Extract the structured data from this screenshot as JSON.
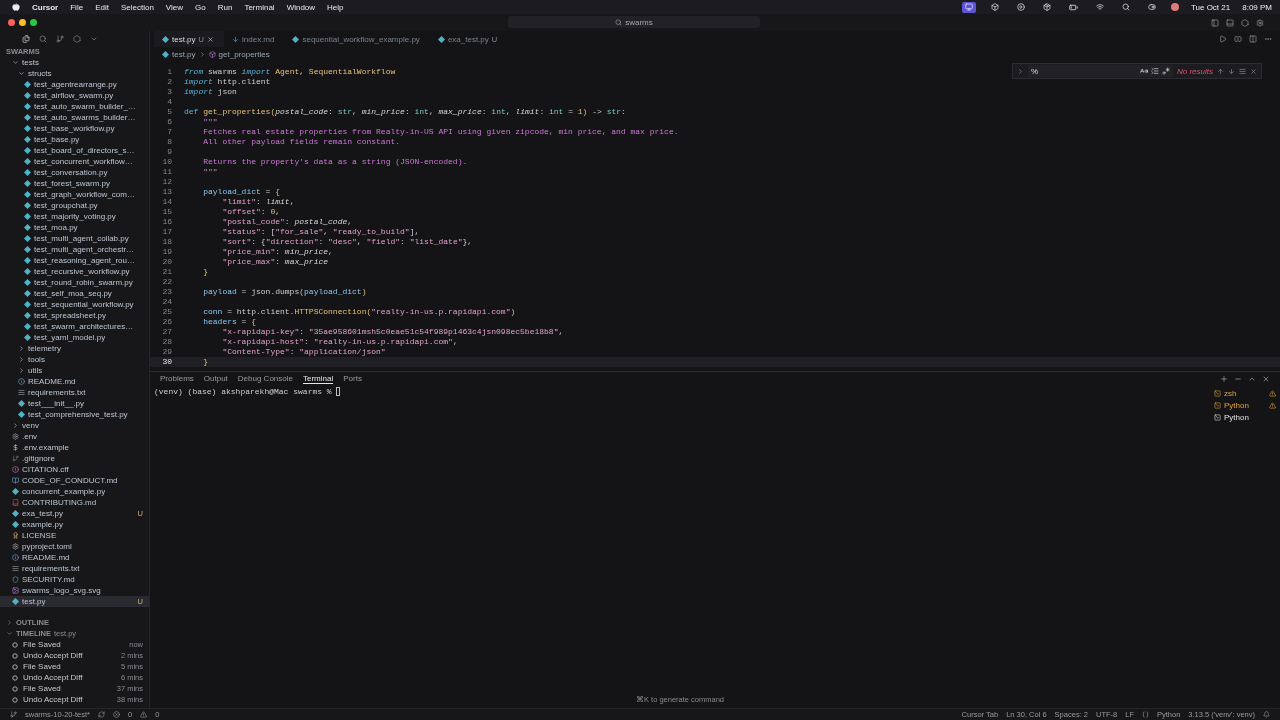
{
  "menu_bar": {
    "app": "Cursor",
    "items": [
      "File",
      "Edit",
      "Selection",
      "View",
      "Go",
      "Run",
      "Terminal",
      "Window",
      "Help"
    ],
    "date": "Tue Oct 21",
    "time": "8:09 PM"
  },
  "title_bar": {
    "search": "swarms"
  },
  "explorer": {
    "title": "SWARMS",
    "tree": [
      {
        "name": "tests",
        "kind": "folder",
        "expanded": true,
        "selected": false,
        "children": [
          {
            "name": "structs",
            "kind": "folder",
            "expanded": true,
            "selected": false,
            "children": [
              {
                "name": "test_agentrearrange.py",
                "kind": "python",
                "selected": false
              },
              {
                "name": "test_airflow_swarm.py",
                "kind": "python",
                "selected": false
              },
              {
                "name": "test_auto_swarm_builder_…",
                "kind": "python",
                "selected": false
              },
              {
                "name": "test_auto_swarms_builder…",
                "kind": "python",
                "selected": false
              },
              {
                "name": "test_base_workflow.py",
                "kind": "python",
                "selected": false
              },
              {
                "name": "test_base.py",
                "kind": "python",
                "selected": false
              },
              {
                "name": "test_board_of_directors_s…",
                "kind": "python",
                "selected": false
              },
              {
                "name": "test_concurrent_workflow…",
                "kind": "python",
                "selected": false
              },
              {
                "name": "test_conversation.py",
                "kind": "python",
                "selected": false
              },
              {
                "name": "test_forest_swarm.py",
                "kind": "python",
                "selected": false
              },
              {
                "name": "test_graph_workflow_com…",
                "kind": "python",
                "selected": false
              },
              {
                "name": "test_groupchat.py",
                "kind": "python",
                "selected": false
              },
              {
                "name": "test_majority_voting.py",
                "kind": "python",
                "selected": false
              },
              {
                "name": "test_moa.py",
                "kind": "python",
                "selected": false
              },
              {
                "name": "test_multi_agent_collab.py",
                "kind": "python",
                "selected": false
              },
              {
                "name": "test_multi_agent_orchestr…",
                "kind": "python",
                "selected": false
              },
              {
                "name": "test_reasoning_agent_rou…",
                "kind": "python",
                "selected": false
              },
              {
                "name": "test_recursive_workflow.py",
                "kind": "python",
                "selected": false
              },
              {
                "name": "test_round_robin_swarm.py",
                "kind": "python",
                "selected": false
              },
              {
                "name": "test_self_moa_seq.py",
                "kind": "python",
                "selected": false
              },
              {
                "name": "test_sequential_workflow.py",
                "kind": "python",
                "selected": false
              },
              {
                "name": "test_spreadsheet.py",
                "kind": "python",
                "selected": false
              },
              {
                "name": "test_swarm_architectures…",
                "kind": "python",
                "selected": false
              },
              {
                "name": "test_yaml_model.py",
                "kind": "python",
                "selected": false
              }
            ]
          },
          {
            "name": "telemetry",
            "kind": "folder",
            "expanded": false,
            "selected": false
          },
          {
            "name": "tools",
            "kind": "folder",
            "expanded": false,
            "selected": false
          },
          {
            "name": "utils",
            "kind": "folder",
            "expanded": false,
            "selected": false
          },
          {
            "name": "README.md",
            "kind": "info",
            "selected": false
          },
          {
            "name": "requirements.txt",
            "kind": "lines",
            "selected": false
          },
          {
            "name": "test___init__.py",
            "kind": "python",
            "selected": false
          },
          {
            "name": "test_comprehensive_test.py",
            "kind": "python",
            "selected": false
          }
        ]
      },
      {
        "name": "venv",
        "kind": "folder",
        "expanded": false,
        "selected": false
      },
      {
        "name": ".env",
        "kind": "gear",
        "selected": false
      },
      {
        "name": ".env.example",
        "kind": "dollar",
        "selected": false
      },
      {
        "name": ".gitignore",
        "kind": "git",
        "selected": false
      },
      {
        "name": "CITATION.cff",
        "kind": "alert",
        "selected": false
      },
      {
        "name": "CODE_OF_CONDUCT.md",
        "kind": "book",
        "selected": false
      },
      {
        "name": "concurrent_example.py",
        "kind": "python",
        "selected": false
      },
      {
        "name": "CONTRIBUTING.md",
        "kind": "redbook",
        "selected": false
      },
      {
        "name": "exa_test.py",
        "kind": "python",
        "selected": false,
        "badge": "U"
      },
      {
        "name": "example.py",
        "kind": "python",
        "selected": false
      },
      {
        "name": "LICENSE",
        "kind": "license",
        "selected": false
      },
      {
        "name": "pyproject.toml",
        "kind": "gear",
        "selected": false
      },
      {
        "name": "README.md",
        "kind": "info",
        "selected": false
      },
      {
        "name": "requirements.txt",
        "kind": "lines",
        "selected": false
      },
      {
        "name": "SECURITY.md",
        "kind": "shield",
        "selected": false
      },
      {
        "name": "swarms_logo_svg.svg",
        "kind": "image",
        "selected": false
      },
      {
        "name": "test.py",
        "kind": "python",
        "selected": true,
        "badge": "U"
      }
    ]
  },
  "outline": {
    "title": "OUTLINE",
    "expanded": false
  },
  "timeline": {
    "title": "TIMELINE",
    "file": "test.py",
    "expanded": true,
    "entries": [
      {
        "label": "File Saved",
        "time": "now"
      },
      {
        "label": "Undo Accept Diff",
        "time": "2 mins"
      },
      {
        "label": "File Saved",
        "time": "5 mins"
      },
      {
        "label": "Undo Accept Diff",
        "time": "6 mins"
      },
      {
        "label": "File Saved",
        "time": "37 mins"
      },
      {
        "label": "Undo Accept Diff",
        "time": "38 mins"
      }
    ]
  },
  "editor": {
    "tabs": [
      {
        "label": "test.py",
        "kind": "python",
        "badge": "U",
        "selected": true
      },
      {
        "label": "index.md",
        "kind": "markdown",
        "selected": false
      },
      {
        "label": "sequential_workflow_example.py",
        "kind": "python",
        "selected": false
      },
      {
        "label": "exa_test.py",
        "kind": "python",
        "badge": "U",
        "selected": false
      }
    ],
    "breadcrumb": [
      "test.py",
      "get_properties"
    ],
    "find": {
      "value": "%",
      "status": "No results"
    },
    "lines": [
      {
        "number": "1",
        "current": false,
        "tokens": [
          {
            "kind": "kw",
            "text": "from"
          },
          {
            "kind": "plain",
            "text": " swarms "
          },
          {
            "kind": "kw",
            "text": "import"
          },
          {
            "kind": "cls",
            "text": " Agent"
          },
          {
            "kind": "plain",
            "text": ", "
          },
          {
            "kind": "cls",
            "text": "SequentialWorkflow"
          }
        ]
      },
      {
        "number": "2",
        "current": false,
        "tokens": [
          {
            "kind": "kw",
            "text": "import"
          },
          {
            "kind": "plain",
            "text": " http.client"
          }
        ]
      },
      {
        "number": "3",
        "current": false,
        "tokens": [
          {
            "kind": "kw",
            "text": "import"
          },
          {
            "kind": "plain",
            "text": " json"
          }
        ]
      },
      {
        "number": "4",
        "current": false
      },
      {
        "number": "5",
        "current": false,
        "tokens": [
          {
            "kind": "def",
            "text": "def"
          },
          {
            "kind": "fn",
            "text": " get_properties"
          },
          {
            "kind": "brace",
            "text": "("
          },
          {
            "kind": "param",
            "text": "postal_code"
          },
          {
            "kind": "plain",
            "text": ": "
          },
          {
            "kind": "type",
            "text": "str"
          },
          {
            "kind": "plain",
            "text": ", "
          },
          {
            "kind": "param",
            "text": "min_price"
          },
          {
            "kind": "plain",
            "text": ": "
          },
          {
            "kind": "type",
            "text": "int"
          },
          {
            "kind": "plain",
            "text": ", "
          },
          {
            "kind": "param",
            "text": "max_price"
          },
          {
            "kind": "plain",
            "text": ": "
          },
          {
            "kind": "type",
            "text": "int"
          },
          {
            "kind": "plain",
            "text": ", "
          },
          {
            "kind": "param",
            "text": "limit"
          },
          {
            "kind": "plain",
            "text": ": "
          },
          {
            "kind": "type",
            "text": "int"
          },
          {
            "kind": "plain",
            "text": " = "
          },
          {
            "kind": "num",
            "text": "1"
          },
          {
            "kind": "brace",
            "text": ")"
          },
          {
            "kind": "plain",
            "text": " -> "
          },
          {
            "kind": "type",
            "text": "str"
          },
          {
            "kind": "plain",
            "text": ":"
          }
        ]
      },
      {
        "number": "6",
        "current": false,
        "tokens": [
          {
            "kind": "doc",
            "text": "    \"\"\""
          }
        ]
      },
      {
        "number": "7",
        "current": false,
        "tokens": [
          {
            "kind": "doc",
            "text": "    Fetches real estate properties from Realty-in-US API using given zipcode, min price, and max price."
          }
        ]
      },
      {
        "number": "8",
        "current": false,
        "tokens": [
          {
            "kind": "doc",
            "text": "    All other payload fields remain constant."
          }
        ]
      },
      {
        "number": "9",
        "current": false
      },
      {
        "number": "10",
        "current": false,
        "tokens": [
          {
            "kind": "doc",
            "text": "    Returns the property's data as a string (JSON-encoded)."
          }
        ]
      },
      {
        "number": "11",
        "current": false,
        "tokens": [
          {
            "kind": "doc",
            "text": "    \"\"\""
          }
        ]
      },
      {
        "number": "12",
        "current": false
      },
      {
        "number": "13",
        "current": false,
        "tokens": [
          {
            "kind": "var",
            "text": "    payload_dict"
          },
          {
            "kind": "plain",
            "text": " = "
          },
          {
            "kind": "brace",
            "text": "{"
          }
        ]
      },
      {
        "number": "14",
        "current": false,
        "tokens": [
          {
            "kind": "str",
            "text": "        \"limit\""
          },
          {
            "kind": "plain",
            "text": ": "
          },
          {
            "kind": "param",
            "text": "limit"
          },
          {
            "kind": "plain",
            "text": ","
          }
        ]
      },
      {
        "number": "15",
        "current": false,
        "tokens": [
          {
            "kind": "str",
            "text": "        \"offset\""
          },
          {
            "kind": "plain",
            "text": ": "
          },
          {
            "kind": "num",
            "text": "0"
          },
          {
            "kind": "plain",
            "text": ","
          }
        ]
      },
      {
        "number": "16",
        "current": false,
        "tokens": [
          {
            "kind": "str",
            "text": "        \"postal_code\""
          },
          {
            "kind": "plain",
            "text": ": "
          },
          {
            "kind": "param",
            "text": "postal_code"
          },
          {
            "kind": "plain",
            "text": ","
          }
        ]
      },
      {
        "number": "17",
        "current": false,
        "tokens": [
          {
            "kind": "str",
            "text": "        \"status\""
          },
          {
            "kind": "plain",
            "text": ": ["
          },
          {
            "kind": "str",
            "text": "\"for_sale\""
          },
          {
            "kind": "plain",
            "text": ", "
          },
          {
            "kind": "str",
            "text": "\"ready_to_build\""
          },
          {
            "kind": "plain",
            "text": "],"
          }
        ]
      },
      {
        "number": "18",
        "current": false,
        "tokens": [
          {
            "kind": "str",
            "text": "        \"sort\""
          },
          {
            "kind": "plain",
            "text": ": {"
          },
          {
            "kind": "str",
            "text": "\"direction\""
          },
          {
            "kind": "plain",
            "text": ": "
          },
          {
            "kind": "str",
            "text": "\"desc\""
          },
          {
            "kind": "plain",
            "text": ", "
          },
          {
            "kind": "str",
            "text": "\"field\""
          },
          {
            "kind": "plain",
            "text": ": "
          },
          {
            "kind": "str",
            "text": "\"list_date\""
          },
          {
            "kind": "plain",
            "text": "},"
          }
        ]
      },
      {
        "number": "19",
        "current": false,
        "tokens": [
          {
            "kind": "str",
            "text": "        \"price_min\""
          },
          {
            "kind": "plain",
            "text": ": "
          },
          {
            "kind": "param",
            "text": "min_price"
          },
          {
            "kind": "plain",
            "text": ","
          }
        ]
      },
      {
        "number": "20",
        "current": false,
        "tokens": [
          {
            "kind": "str",
            "text": "        \"price_max\""
          },
          {
            "kind": "plain",
            "text": ": "
          },
          {
            "kind": "param",
            "text": "max_price"
          }
        ]
      },
      {
        "number": "21",
        "current": false,
        "tokens": [
          {
            "kind": "brace",
            "text": "    }"
          }
        ]
      },
      {
        "number": "22",
        "current": false
      },
      {
        "number": "23",
        "current": false,
        "tokens": [
          {
            "kind": "var",
            "text": "    payload"
          },
          {
            "kind": "plain",
            "text": " = json.dumps"
          },
          {
            "kind": "brace",
            "text": "("
          },
          {
            "kind": "var",
            "text": "payload_dict"
          },
          {
            "kind": "brace",
            "text": ")"
          }
        ]
      },
      {
        "number": "24",
        "current": false
      },
      {
        "number": "25",
        "current": false,
        "tokens": [
          {
            "kind": "var",
            "text": "    conn"
          },
          {
            "kind": "plain",
            "text": " = http.client."
          },
          {
            "kind": "fn",
            "text": "HTTPSConnection"
          },
          {
            "kind": "brace",
            "text": "("
          },
          {
            "kind": "str",
            "text": "\"realty-in-us.p.rapidapi.com\""
          },
          {
            "kind": "brace",
            "text": ")"
          }
        ]
      },
      {
        "number": "26",
        "current": false,
        "tokens": [
          {
            "kind": "var",
            "text": "    headers"
          },
          {
            "kind": "plain",
            "text": " = "
          },
          {
            "kind": "brace",
            "text": "{"
          }
        ]
      },
      {
        "number": "27",
        "current": false,
        "tokens": [
          {
            "kind": "str",
            "text": "        \"x-rapidapi-key\""
          },
          {
            "kind": "plain",
            "text": ": "
          },
          {
            "kind": "str",
            "text": "\"35ae958601msh5c0eae51c54f989p1463c4jsn098ec5be18b8\""
          },
          {
            "kind": "plain",
            "text": ","
          }
        ]
      },
      {
        "number": "28",
        "current": false,
        "tokens": [
          {
            "kind": "str",
            "text": "        \"x-rapidapi-host\""
          },
          {
            "kind": "plain",
            "text": ": "
          },
          {
            "kind": "str",
            "text": "\"realty-in-us.p.rapidapi.com\""
          },
          {
            "kind": "plain",
            "text": ","
          }
        ]
      },
      {
        "number": "29",
        "current": false,
        "tokens": [
          {
            "kind": "str",
            "text": "        \"Content-Type\""
          },
          {
            "kind": "plain",
            "text": ": "
          },
          {
            "kind": "str",
            "text": "\"application/json\""
          }
        ]
      },
      {
        "number": "30",
        "current": true,
        "tokens": [
          {
            "kind": "brace",
            "text": "    }"
          }
        ]
      }
    ]
  },
  "panel": {
    "tabs": [
      {
        "label": "Problems",
        "selected": false
      },
      {
        "label": "Output",
        "selected": false
      },
      {
        "label": "Debug Console",
        "selected": false
      },
      {
        "label": "Terminal",
        "selected": true
      },
      {
        "label": "Ports",
        "selected": false
      }
    ],
    "prompt": "(venv) (base) akshparekh@Mac swarms % ",
    "hint": "⌘K to generate command",
    "terminals": [
      {
        "label": "zsh",
        "warning": true
      },
      {
        "label": "Python",
        "warning": true
      },
      {
        "label": "Python",
        "warning": false
      }
    ]
  },
  "status_bar": {
    "branch": "swarms-10-20-test*",
    "errors": "0",
    "warnings": "0",
    "items": [
      "Cursor Tab",
      "Ln 30, Col 6",
      "Spaces: 2",
      "UTF-8",
      "LF"
    ],
    "language": "Python",
    "interpreter": "3.13.5 ('venv': venv)"
  }
}
